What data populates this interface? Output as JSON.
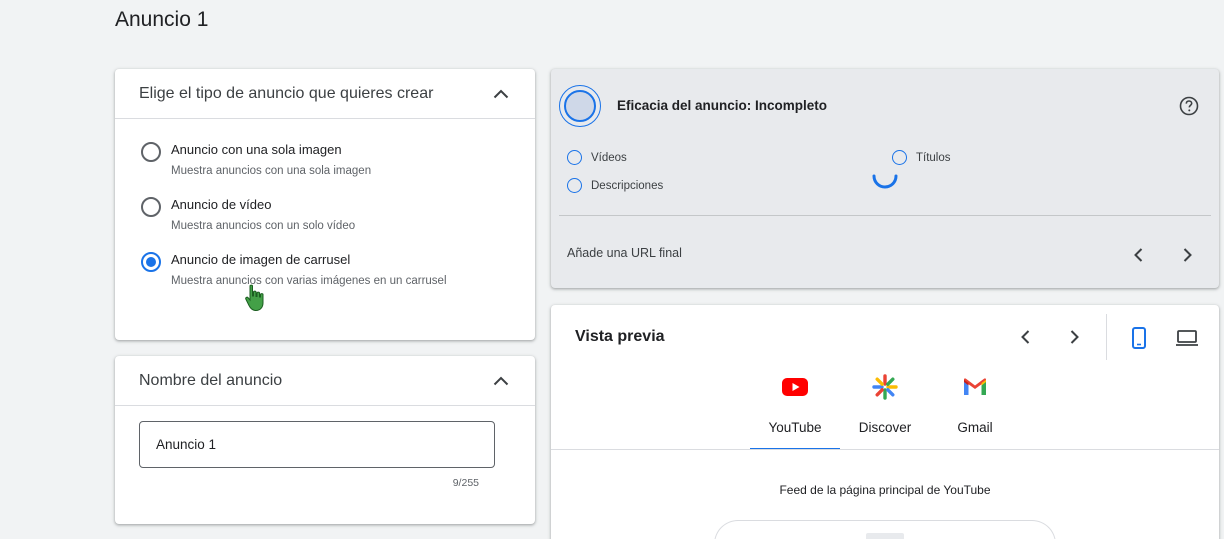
{
  "page": {
    "title": "Anuncio 1"
  },
  "ad_type": {
    "title": "Elige el tipo de anuncio que quieres crear",
    "options": [
      {
        "label": "Anuncio con una sola imagen",
        "description": "Muestra anuncios con una sola imagen",
        "selected": false
      },
      {
        "label": "Anuncio de vídeo",
        "description": "Muestra anuncios con un solo vídeo",
        "selected": false
      },
      {
        "label": "Anuncio de imagen de carrusel",
        "description": "Muestra anuncios con varias imágenes en un carrusel",
        "selected": true
      }
    ]
  },
  "ad_name": {
    "title": "Nombre del anuncio",
    "value": "Anuncio 1",
    "counter": "9/255"
  },
  "effectiveness": {
    "title": "Eficacia del anuncio: Incompleto",
    "items": {
      "videos": "Vídeos",
      "titles": "Títulos",
      "descriptions": "Descripciones"
    },
    "url_hint": "Añade una URL final"
  },
  "preview": {
    "title": "Vista previa",
    "tabs": [
      {
        "label": "YouTube",
        "active": true
      },
      {
        "label": "Discover",
        "active": false
      },
      {
        "label": "Gmail",
        "active": false
      }
    ],
    "feed_label": "Feed de la página principal de YouTube"
  },
  "colors": {
    "accent": "#1a73e8",
    "youtube_red": "#ff0000",
    "background": "#f1f3f4"
  }
}
